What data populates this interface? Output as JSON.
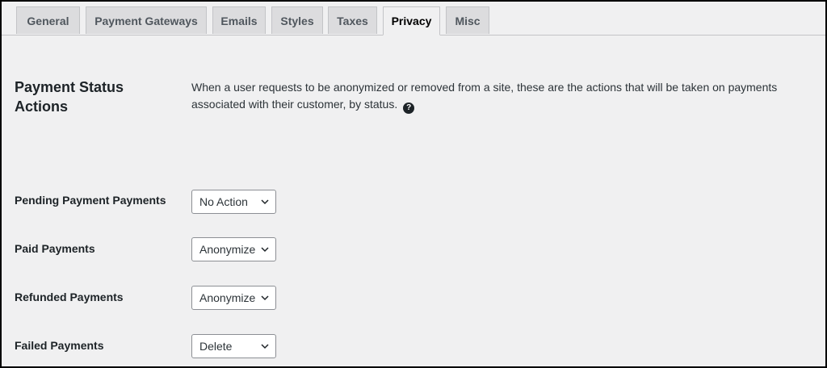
{
  "tabs": [
    {
      "label": "General"
    },
    {
      "label": "Payment Gateways"
    },
    {
      "label": "Emails"
    },
    {
      "label": "Styles"
    },
    {
      "label": "Taxes"
    },
    {
      "label": "Privacy",
      "active": true
    },
    {
      "label": "Misc"
    }
  ],
  "section": {
    "title": "Payment Status Actions",
    "description": "When a user requests to be anonymized or removed from a site, these are the actions that will be taken on payments associated with their customer, by status.",
    "help_icon": "?"
  },
  "rows": [
    {
      "label": "Pending Payment Payments",
      "selected": "No Action"
    },
    {
      "label": "Paid Payments",
      "selected": "Anonymize"
    },
    {
      "label": "Refunded Payments",
      "selected": "Anonymize"
    },
    {
      "label": "Failed Payments",
      "selected": "Delete"
    }
  ],
  "icons": {
    "help": "question-circle-icon",
    "dropdown": "chevron-down-icon"
  },
  "colors": {
    "background": "#f0f0f1",
    "tab_inactive": "#dcdcde",
    "border": "#c3c4c7",
    "text": "#1d2327"
  }
}
